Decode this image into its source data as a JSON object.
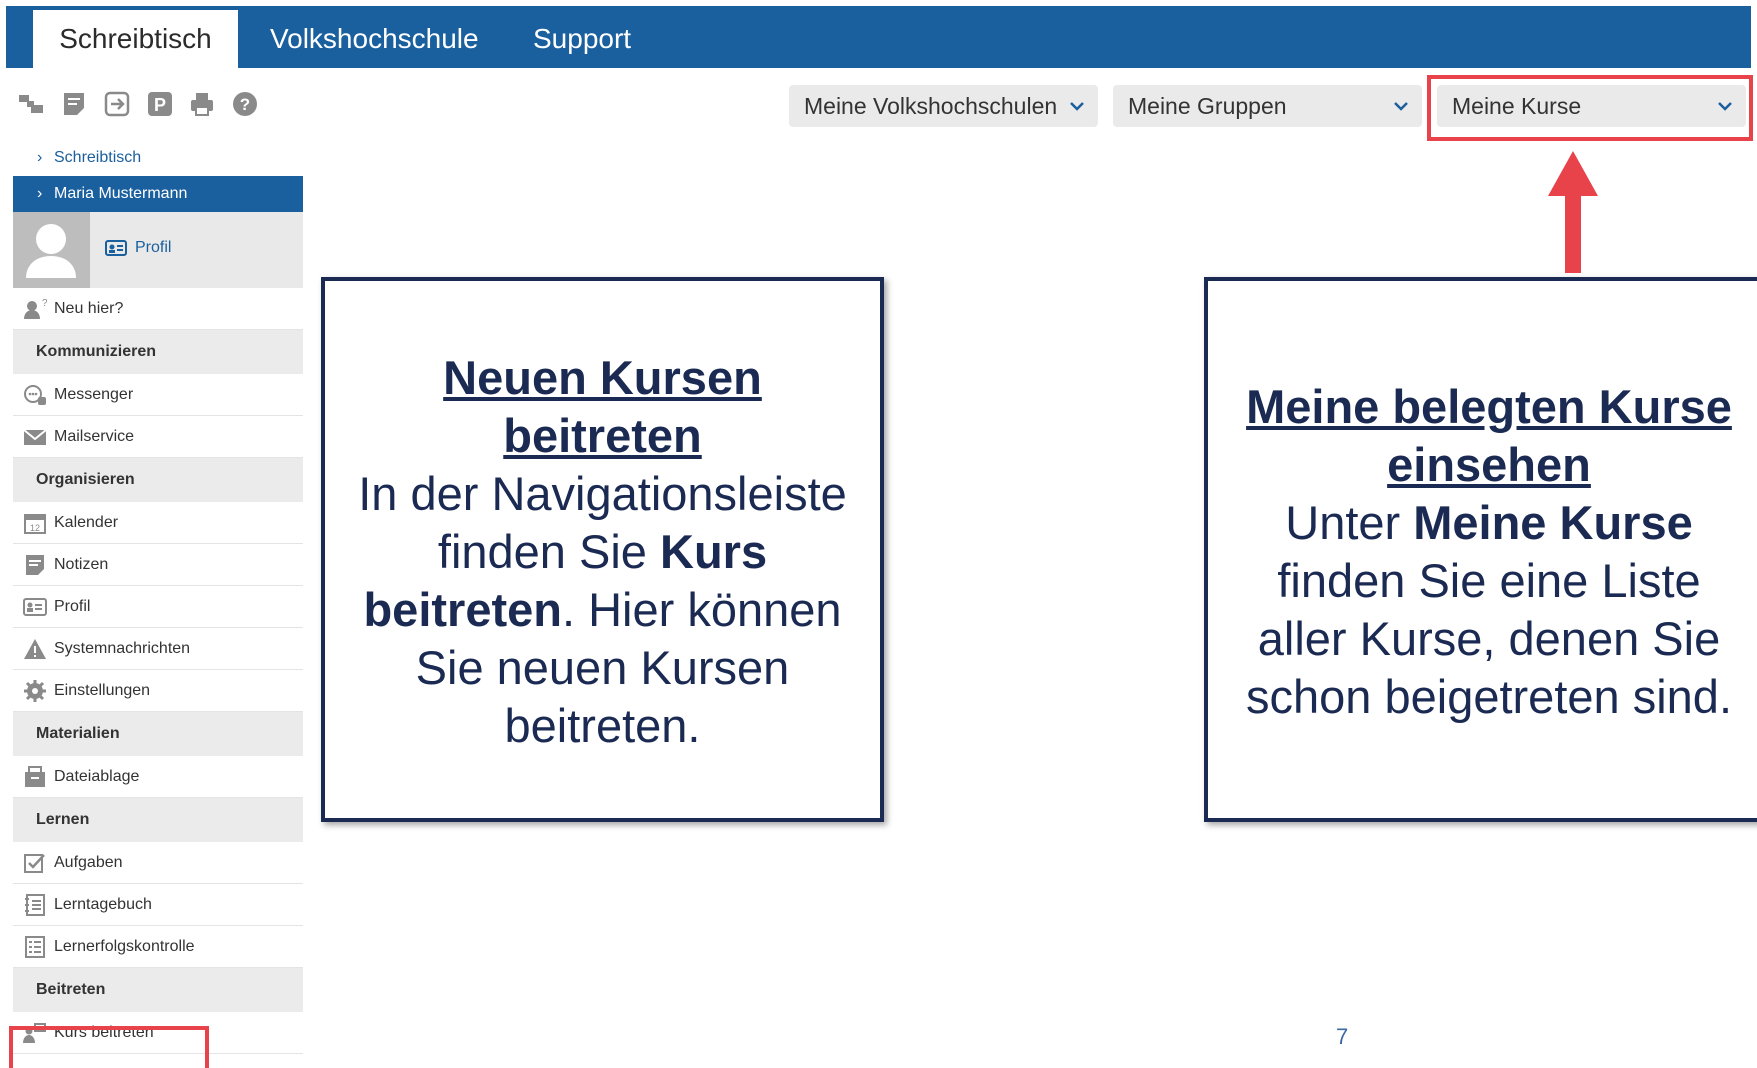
{
  "tabs": [
    {
      "label": "Schreibtisch",
      "active": true
    },
    {
      "label": "Volkshochschule",
      "active": false
    },
    {
      "label": "Support",
      "active": false
    }
  ],
  "toolbar_icons": [
    "switch-icon",
    "notes-icon",
    "logout-icon",
    "parking-icon",
    "print-icon",
    "help-icon"
  ],
  "dropdowns": {
    "vhs": "Meine Volkshochschulen",
    "groups": "Meine Gruppen",
    "courses": "Meine Kurse"
  },
  "sidebar": {
    "breadcrumb": "Schreibtisch",
    "user": "Maria Mustermann",
    "profile_link": "Profil",
    "new_here": "Neu hier?",
    "sections": {
      "communicate": "Kommunizieren",
      "organize": "Organisieren",
      "materials": "Materialien",
      "learn": "Lernen",
      "join": "Beitreten"
    },
    "items": {
      "messenger": "Messenger",
      "mailservice": "Mailservice",
      "calendar": "Kalender",
      "notes": "Notizen",
      "profile": "Profil",
      "system_messages": "Systemnachrichten",
      "settings": "Einstellungen",
      "file_storage": "Dateiablage",
      "tasks": "Aufgaben",
      "learning_diary": "Lerntagebuch",
      "learning_check": "Lernerfolgskontrolle",
      "join_course": "Kurs beitreten"
    }
  },
  "callout_left": {
    "heading_1": "Neuen Kursen",
    "heading_2": "beitreten",
    "line_1": "In der Navigationsleiste",
    "line_2a": "finden Sie ",
    "line_2b": "Kurs",
    "line_3a": "beitreten",
    "line_3b": ". Hier können",
    "line_4": "Sie neuen Kursen",
    "line_5": "beitreten."
  },
  "callout_right": {
    "heading_1": "Meine belegten Kurse",
    "heading_2": "einsehen",
    "line_1a": "Unter ",
    "line_1b": "Meine Kurse",
    "line_2": "finden Sie eine Liste",
    "line_3": "aller Kurse, denen Sie",
    "line_4": "schon beigetreten sind."
  },
  "colors": {
    "nav_blue": "#1a5f9e",
    "highlight_red": "#e8424a",
    "callout_navy": "#1b2a52"
  },
  "page_number": "7"
}
